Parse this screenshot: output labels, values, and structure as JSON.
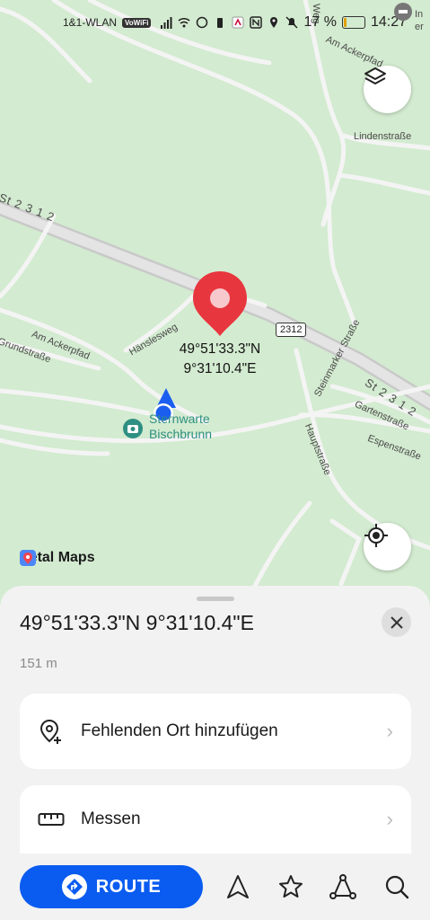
{
  "status_bar": {
    "carrier": "1&1-WLAN",
    "vowifi": "VoWiFi",
    "battery_percent": "17 %",
    "battery_level": 0.17,
    "time": "14:27"
  },
  "map": {
    "road_labels": {
      "st2312_west": "St 2 3 1 2",
      "st2312_east": "St 2 3 1 2",
      "am_ackerpfad_ne": "Am Ackerpfad",
      "lindenstrasse": "Lindenstraße",
      "am_ackerpfad_w": "Am Ackerpfad",
      "grundstrasse": "Grundstraße",
      "haenslesweg": "Hänslesweg",
      "steinmarker_strasse": "Steinmarker Straße",
      "hauptstrasse": "Hauptstraße",
      "gartenstrasse": "Gartenstraße",
      "espenstrasse": "Espenstraße",
      "top_road": "Weg",
      "corner_text_1": "In",
      "corner_text_2": "er"
    },
    "road_shield": "2312",
    "pin_coords": {
      "lat": "49°51'33.3\"N",
      "lon": "9°31'10.4\"E"
    },
    "poi": {
      "line1": "Sternwarte",
      "line2": "Bischbrunn",
      "icon": "camera-icon"
    },
    "brand": "Petal Maps"
  },
  "sheet": {
    "title": "49°51'33.3\"N 9°31'10.4\"E",
    "distance": "151 m",
    "actions": [
      {
        "label": "Fehlenden Ort hinzufügen",
        "icon": "add-location-icon"
      },
      {
        "label": "Messen",
        "icon": "ruler-icon"
      }
    ]
  },
  "bottom_bar": {
    "route_label": "ROUTE",
    "icons": [
      "navigation-icon",
      "star-icon",
      "route-points-icon",
      "search-icon"
    ]
  },
  "colors": {
    "map_background": "#d3ebd0",
    "pin_red": "#e8363f",
    "route_blue": "#0a5cf0",
    "location_blue": "#1a5ef0",
    "poi_teal": "#2f8f83"
  }
}
